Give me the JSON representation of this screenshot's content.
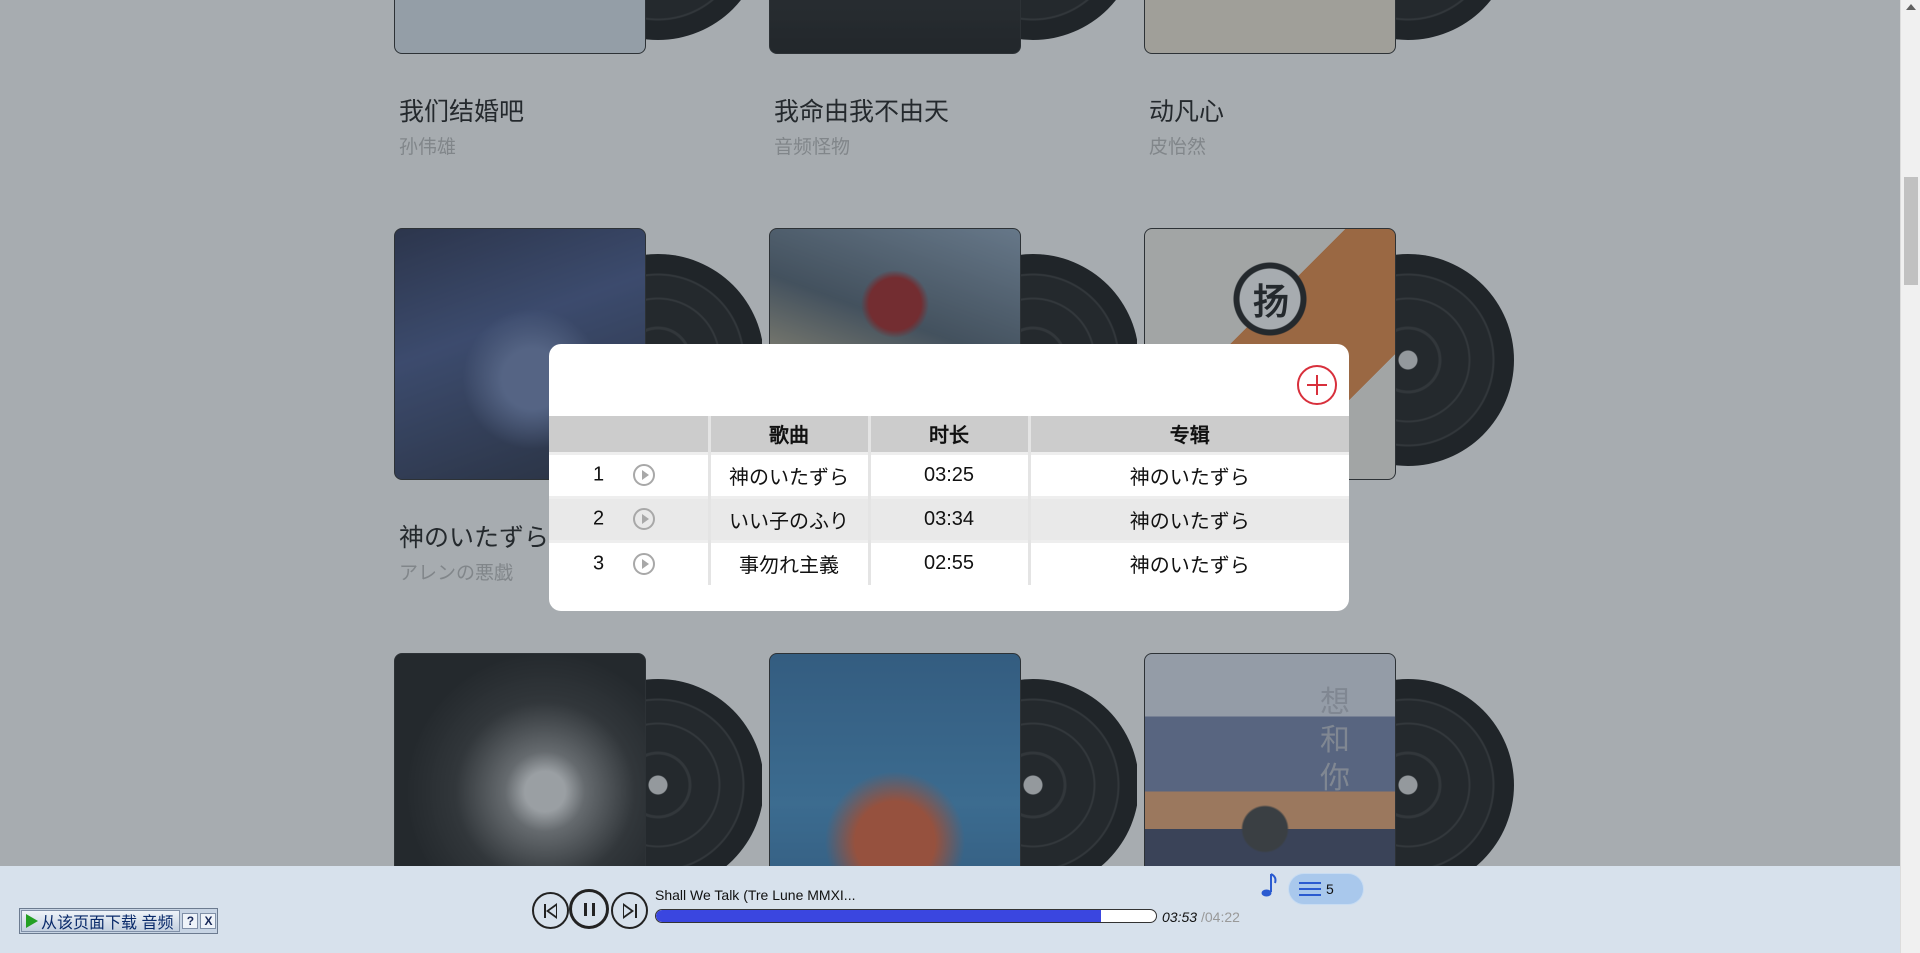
{
  "albums": [
    {
      "title": "我们结婚吧",
      "artist": "孙伟雄"
    },
    {
      "title": "我命由我不由天",
      "artist": "音频怪物"
    },
    {
      "title": "动凡心",
      "artist": "皮怡然"
    },
    {
      "title": "神のいたずら",
      "artist": "アレンの悪戯"
    },
    {
      "title": "",
      "artist": ""
    },
    {
      "title": "",
      "artist": ""
    },
    {
      "title": "",
      "artist": ""
    },
    {
      "title": "",
      "artist": ""
    },
    {
      "title": "",
      "artist": ""
    }
  ],
  "album_cover_text": {
    "fu_text": "想和你",
    "badge_char": "扬"
  },
  "modal": {
    "headers": {
      "index": "",
      "song": "歌曲",
      "duration": "时长",
      "album": "专辑"
    },
    "rows": [
      {
        "index": "1",
        "song": "神のいたずら",
        "duration": "03:25",
        "album": "神のいたずら"
      },
      {
        "index": "2",
        "song": "いい子のふり",
        "duration": "03:34",
        "album": "神のいたずら"
      },
      {
        "index": "3",
        "song": "事勿れ主義",
        "duration": "02:55",
        "album": "神のいたずら"
      }
    ],
    "close_icon": "circle-plus-icon"
  },
  "player": {
    "download_label": "从该页面下载 音频",
    "help_label": "?",
    "close_label": "X",
    "now_playing": "Shall We Talk (Tre Lune MMXI...",
    "current_time": "03:53",
    "total_time": "/04:22",
    "progress": 0.89,
    "queue_count": "5"
  },
  "colors": {
    "overlay": "rgba(60,70,80,0.45)",
    "progress_fill": "#3a46e0",
    "close_icon": "#d8303c",
    "player_bg": "#d7e1ec",
    "queue_pill": "#a9c8ec"
  }
}
